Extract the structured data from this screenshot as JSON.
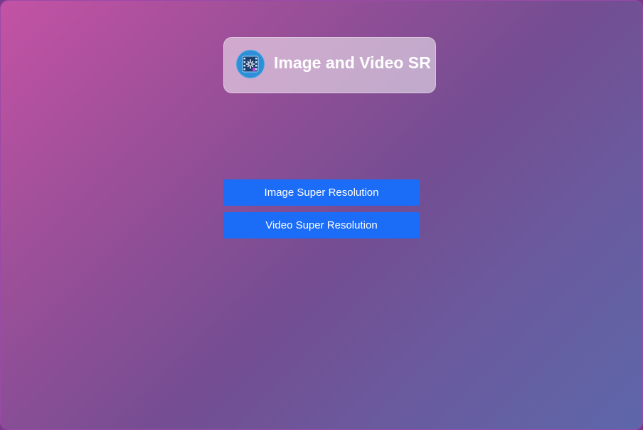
{
  "app": {
    "title": "Image and Video SR",
    "icon": "film-sparkle-icon"
  },
  "actions": {
    "image_sr_label": "Image Super Resolution",
    "video_sr_label": "Video Super Resolution"
  },
  "colors": {
    "button": "#1b6cf7",
    "gradient_start": "#c452a4",
    "gradient_end": "#5d67aa"
  }
}
